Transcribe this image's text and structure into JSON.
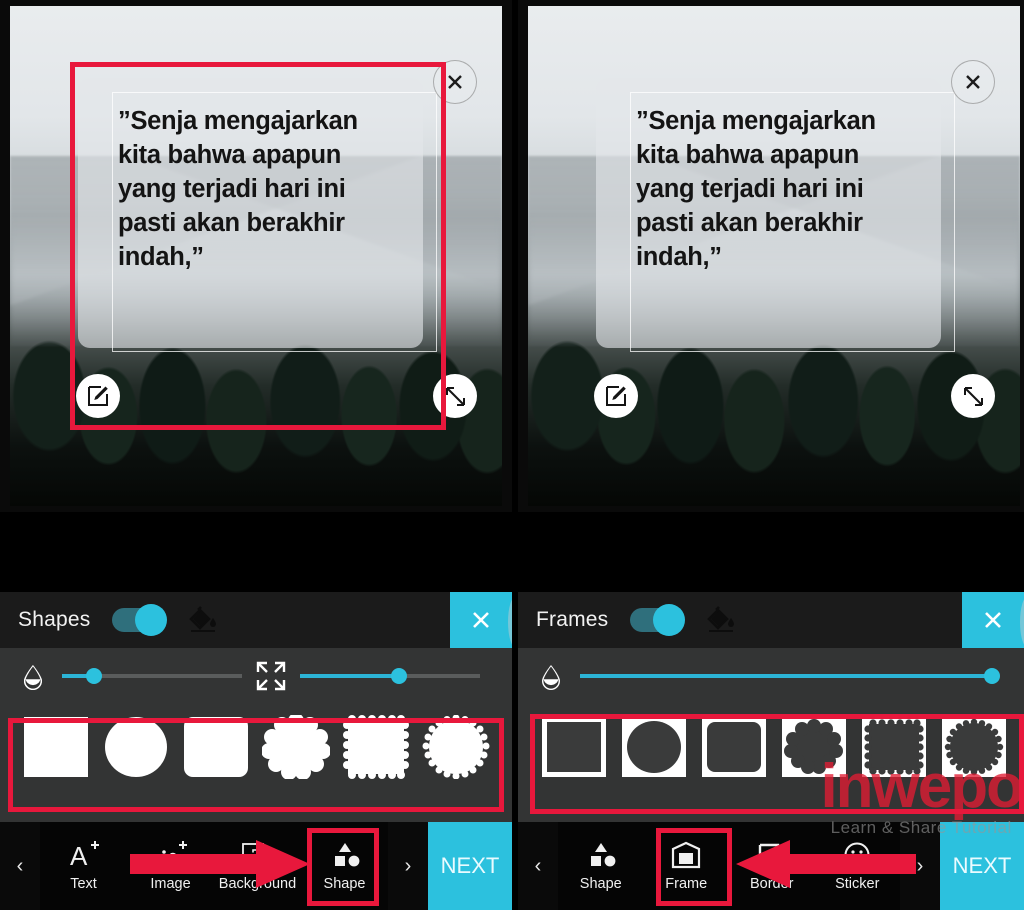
{
  "app": {
    "accent_cyan": "#2CC1DE",
    "annotation_red": "#E8183C",
    "panel_bg": "#333434",
    "header_bg": "#1B1B1B"
  },
  "canvas": {
    "quote_text": "”Senja mengajarkan\nkita bahwa apapun\nyang terjadi hari ini\npasti akan berakhir\nindah,”",
    "close_icon": "close-icon",
    "edit_icon": "edit-pencil-icon",
    "resize_icon": "resize-diagonal-icon"
  },
  "left_panel": {
    "tool_panel": {
      "title": "Shapes",
      "toggle_on": true,
      "fill_icon": "paint-bucket-icon",
      "close_label": "×",
      "sliders": [
        {
          "name": "opacity",
          "icon": "droplet-icon",
          "value": 18
        },
        {
          "name": "size",
          "icon": "shrink-icon",
          "value": 55
        }
      ],
      "swatches": [
        {
          "name": "square",
          "shape": "square"
        },
        {
          "name": "circle",
          "shape": "circle"
        },
        {
          "name": "rounded-square",
          "shape": "rounded"
        },
        {
          "name": "cloud",
          "shape": "cloud"
        },
        {
          "name": "stamp-square",
          "shape": "stamp"
        },
        {
          "name": "starburst",
          "shape": "starburst"
        }
      ],
      "swatch_style": "solid-white"
    },
    "bottom_bar": {
      "prev_arrow": "‹",
      "next_arrow": "›",
      "next_label": "NEXT",
      "tools": [
        {
          "label": "Text",
          "icon": "add-text-icon",
          "highlighted": false
        },
        {
          "label": "Image",
          "icon": "add-image-icon",
          "highlighted": false
        },
        {
          "label": "Background",
          "icon": "background-icon",
          "highlighted": false
        },
        {
          "label": "Shape",
          "icon": "shape-icon",
          "highlighted": true
        }
      ]
    }
  },
  "right_panel": {
    "tool_panel": {
      "title": "Frames",
      "toggle_on": true,
      "fill_icon": "paint-bucket-icon",
      "close_label": "×",
      "sliders": [
        {
          "name": "opacity",
          "icon": "droplet-icon",
          "value": 100
        }
      ],
      "swatches": [
        {
          "name": "square-frame",
          "shape": "square"
        },
        {
          "name": "circle-frame",
          "shape": "circle"
        },
        {
          "name": "rounded-square-frame",
          "shape": "rounded"
        },
        {
          "name": "cloud-frame",
          "shape": "cloud"
        },
        {
          "name": "stamp-square-frame",
          "shape": "stamp"
        },
        {
          "name": "starburst-frame",
          "shape": "starburst"
        }
      ],
      "swatch_style": "framed-inverse"
    },
    "bottom_bar": {
      "prev_arrow": "‹",
      "next_arrow": "›",
      "next_label": "NEXT",
      "tools": [
        {
          "label": "Shape",
          "icon": "shape-icon",
          "highlighted": false
        },
        {
          "label": "Frame",
          "icon": "frame-icon",
          "highlighted": true
        },
        {
          "label": "Border",
          "icon": "border-icon",
          "highlighted": false
        },
        {
          "label": "Sticker",
          "icon": "sticker-smiley-icon",
          "highlighted": false
        }
      ]
    }
  },
  "watermark": {
    "main": "inwepo",
    "sub": "Learn & Share Tutorial"
  }
}
